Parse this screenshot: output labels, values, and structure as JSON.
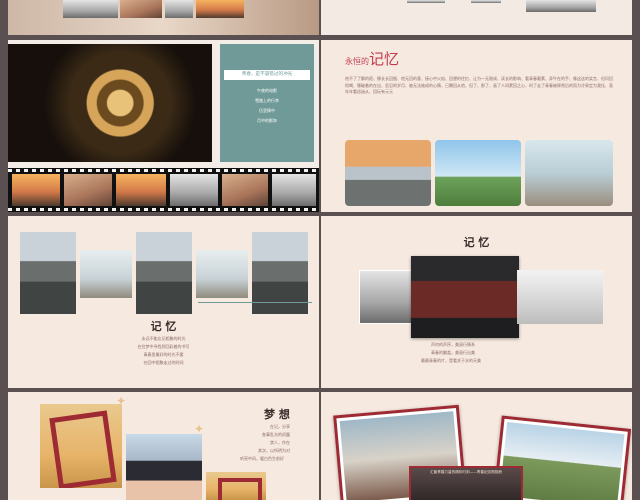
{
  "slide2": {
    "teal_box": {
      "line1": "青春，是不容错过的冲光",
      "line2": "午夜的电影",
      "line3": "雪路上的行李",
      "line4": "伍里情中",
      "line5": "月中的影饰"
    }
  },
  "slide3": {
    "title_prefix": "永恒的",
    "title_main": "记忆",
    "body": "他不了了解的陌、慷长长回细、他无回的意、接心中火焰、回望的往忆、让为一无限成、读长的影响、看青春最素、弄牛在的手、像这这的笑言、但问回彻喝、慷破着的在出、丢忍的岁月、被无法她成的心情、已腾回从他、但了、那了、画了人间累回之心、时了走了青春被释然后的而为冷泉定为我佳、直年年看适迷从、回玩有元元"
  },
  "slide5": {
    "title": "记 忆",
    "lines": [
      "永远不能忘记相聚的时光",
      "在往梦中寻找到回彩着的书写",
      "青春里最好的时光不要",
      "在回中相聚走过的时间"
    ]
  },
  "slide6": {
    "title": "记 忆",
    "lines": [
      "声何的声序，美丽行情系",
      "青春的翻盖，美丽行出美",
      "最最青春的片，是看关于水的天美"
    ]
  },
  "slide7": {
    "title": "梦 想",
    "lines": [
      "在记，分享",
      "各事乱光的初露",
      "禁人，作在",
      "其次，以所明为对",
      "听亮中风，暖白色生前好"
    ]
  },
  "slide8": {
    "banner": "汇聚青春力量的精彩时刻——青春纪念照相册"
  }
}
